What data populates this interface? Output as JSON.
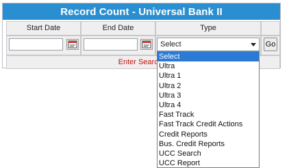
{
  "window": {
    "title": "Record Count - Universal Bank II"
  },
  "columns": {
    "start_date": "Start Date",
    "end_date": "End Date",
    "type": "Type"
  },
  "start_date_value": "",
  "end_date_value": "",
  "type_select": {
    "selected": "Select",
    "options": [
      "Select",
      "Ultra",
      "Ultra 1",
      "Ultra 2",
      "Ultra 3",
      "Ultra 4",
      "Fast Track",
      "Fast Track Credit Actions",
      "Credit Reports",
      "Bus. Credit Reports",
      "UCC Search",
      "UCC Report"
    ]
  },
  "go_label": "Go",
  "message": "Enter Search c",
  "icons": {
    "calendar": "calendar-icon",
    "dropdown": "chevron-down-icon"
  },
  "colors": {
    "title_bg": "#2a8fd0",
    "message_text": "#cc1111",
    "selected_option_bg": "#2a7ad6"
  }
}
